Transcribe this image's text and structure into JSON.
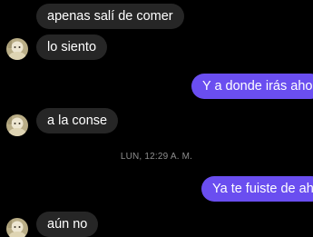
{
  "thread": {
    "messages": [
      {
        "direction": "in",
        "text": "apenas salí de comer"
      },
      {
        "direction": "in",
        "text": "lo siento",
        "avatar": "contact-avatar"
      },
      {
        "direction": "out",
        "text": "Y a donde irás ahora"
      },
      {
        "direction": "in",
        "text": "a la conse",
        "avatar": "contact-avatar"
      },
      {
        "direction": "out",
        "text": "Ya te fuiste de ahí?"
      },
      {
        "direction": "in",
        "text": "aún no",
        "avatar": "contact-avatar"
      }
    ],
    "timestamp": "LUN, 12:29 A. M."
  },
  "colors": {
    "background": "#000000",
    "incoming_bubble": "#262626",
    "outgoing_bubble": "#6a4ef0",
    "timestamp_text": "#8e8e8e"
  }
}
